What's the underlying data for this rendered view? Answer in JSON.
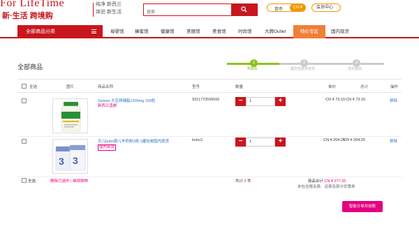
{
  "header": {
    "logo_en": "For LifeTime",
    "logo_cn": "新·生活  跨境购",
    "slogan_line1": "纯净 新西兰",
    "slogan_line2": "体验 新生活",
    "search_placeholder": "搜索",
    "currency_label": "货币",
    "currency_value": "CN ¥",
    "member_label": "会员中心"
  },
  "nav": {
    "all_categories": "全部商品分类",
    "items": [
      "母婴馆",
      "蜂蜜馆",
      "健康馆",
      "美丽馆",
      "美食馆",
      "时尚馆",
      "大牌Outlet",
      "特价专区",
      "国内现货"
    ],
    "active_index": 7
  },
  "page": {
    "title": "全部商品"
  },
  "steps": {
    "numbers": [
      "1",
      "2",
      "3"
    ],
    "labels": [
      "购物车",
      "提交信息并支付",
      "支付成功"
    ],
    "current": 1
  },
  "table": {
    "headers": {
      "select_all": "全选",
      "image": "图片",
      "name": "商品名称",
      "sku": "型号",
      "qty": "数量",
      "price": "单价",
      "total": "总计",
      "op": "操作"
    },
    "rows": [
      {
        "name": "Swisse 大豆卵磷脂1200mg 150粒",
        "origin": "新西兰直邮",
        "sku": "9311770599566",
        "qty": "1",
        "price": "CN ¥ 73.10",
        "total": "CN ¥ 73.10",
        "delete": "移除"
      },
      {
        "name": "贝儿bubs婴儿羊奶粉3段 1罐包邮国内现货",
        "origin": "国内现货",
        "sku": "bubs3",
        "qty": "1",
        "price": "CN ¥ 204.25",
        "total": "CN ¥ 204.25",
        "delete": "移除"
      }
    ]
  },
  "footer": {
    "select_all": "全选",
    "ops": "删除已选中 | 继续购物",
    "count_label": "共计",
    "count_value": "2",
    "count_unit": "件",
    "sum_label": "商品合计",
    "sum_value": "CN ¥ 277.35",
    "note": "未包含报关费、运费及部分优惠券",
    "checkout": "智能分单并结账"
  },
  "colors": {
    "brand": "#c8161d",
    "accent": "#f39800",
    "pink": "#e4007f",
    "step_done": "#8dc21f",
    "nav_active": "#f07f39"
  },
  "icons": [
    "search-icon",
    "menu-icon",
    "minus-icon",
    "plus-icon"
  ]
}
